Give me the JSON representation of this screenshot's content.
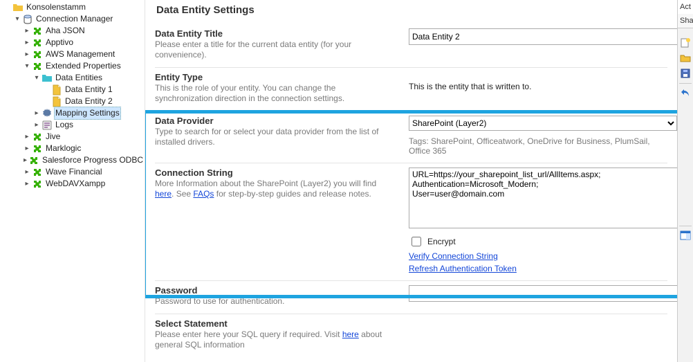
{
  "tree": {
    "root": "Konsolenstamm",
    "cm": "Connection Manager",
    "items": [
      "Aha JSON",
      "Apptivo",
      "AWS Management",
      "Extended Properties",
      "Jive",
      "Marklogic",
      "Salesforce Progress ODBC",
      "Wave Financial",
      "WebDAVXampp"
    ],
    "ep_children": {
      "data_entities": "Data Entities",
      "de1": "Data Entity 1",
      "de2": "Data Entity 2",
      "mapping": "Mapping Settings",
      "logs": "Logs"
    }
  },
  "page_title": "Data Entity Settings",
  "title_section": {
    "label": "Data Entity Title",
    "desc": "Please enter a title for the current data entity (for your convenience).",
    "value": "Data Entity 2"
  },
  "entity_type": {
    "label": "Entity Type",
    "desc": "This is the role of your entity. You can change the synchronization direction in the connection settings.",
    "value": "This is the entity that is written to."
  },
  "provider": {
    "label": "Data Provider",
    "desc": "Type to search for or select your data provider from the list of installed drivers.",
    "value": "SharePoint (Layer2)",
    "tags": "Tags: SharePoint, Officeatwork, OneDrive for Business, PlumSail, Office 365"
  },
  "conn": {
    "label": "Connection String",
    "desc_pre": "More Information about the SharePoint (Layer2) you will find ",
    "here": "here",
    "desc_mid": ". See ",
    "faqs": "FAQs",
    "desc_post": " for step-by-step guides and release notes.",
    "value": "URL=https://your_sharepoint_list_url/AllItems.aspx;\nAuthentication=Microsoft_Modern;\nUser=user@domain.com",
    "encrypt": "Encrypt",
    "verify": "Verify Connection String",
    "refresh": "Refresh Authentication Token"
  },
  "password": {
    "label": "Password",
    "desc": "Password to use for authentication."
  },
  "select_stmt": {
    "label": "Select Statement",
    "desc_pre": "Please enter here your SQL query if required. Visit ",
    "here": "here",
    "desc_post": " about general SQL information"
  },
  "rbar": {
    "tab0": "Act",
    "tab1": "Sha"
  }
}
